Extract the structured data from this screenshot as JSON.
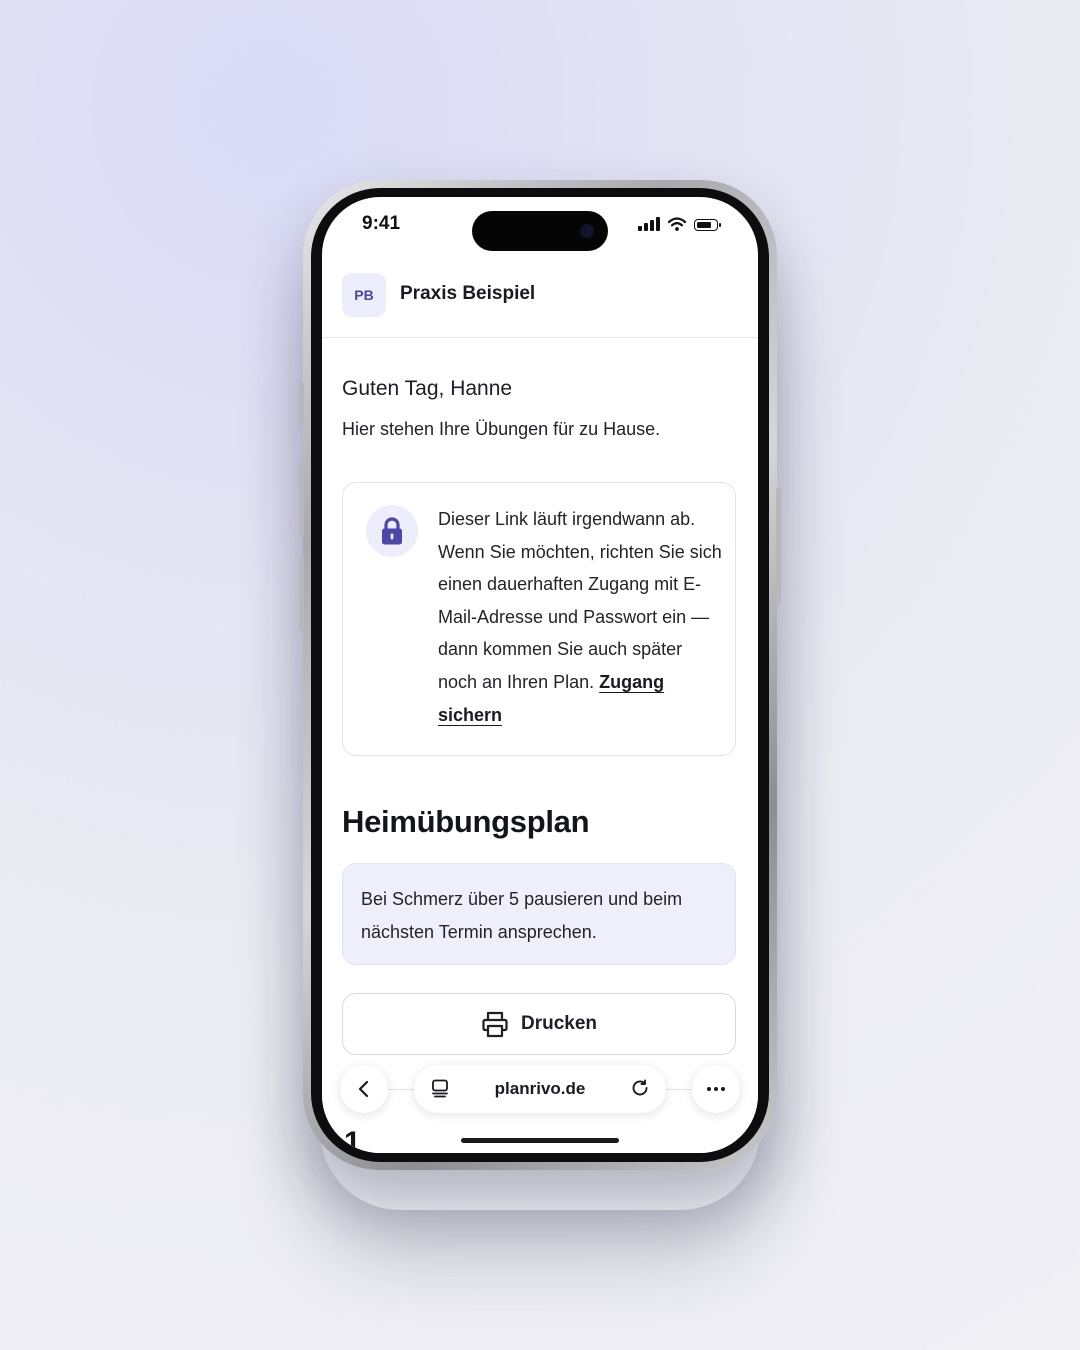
{
  "status_bar": {
    "time": "9:41",
    "signal_bars": 4,
    "battery_level": 0.8
  },
  "header": {
    "logo_initials": "PB",
    "practice_name": "Praxis Beispiel"
  },
  "main": {
    "greeting": "Guten Tag, Hanne",
    "intro": "Hier stehen Ihre Übungen für zu Hause.",
    "notice": {
      "text": "Dieser Link läuft irgendwann ab. Wenn Sie möchten, richten Sie sich einen dauerhaften Zugang mit E-Mail-Adresse und Passwort ein — dann kommen Sie auch später noch an Ihren Plan.",
      "link_label": "Zugang sichern",
      "icon": "lock-icon"
    },
    "plan_title": "Heimübungsplan",
    "pain_hint": "Bei Schmerz über 5 pausieren und beim nächsten Termin ansprechen.",
    "print_label": "Drucken",
    "next_item_number": "1"
  },
  "browser": {
    "url": "planrivo.de",
    "icons": [
      "back-icon",
      "tabs-icon",
      "reload-icon",
      "more-icon"
    ]
  },
  "colors": {
    "accent": "#4b46a8",
    "accent_soft": "#ededfb",
    "info_bg": "#efeffc",
    "text": "#1e1e26"
  }
}
